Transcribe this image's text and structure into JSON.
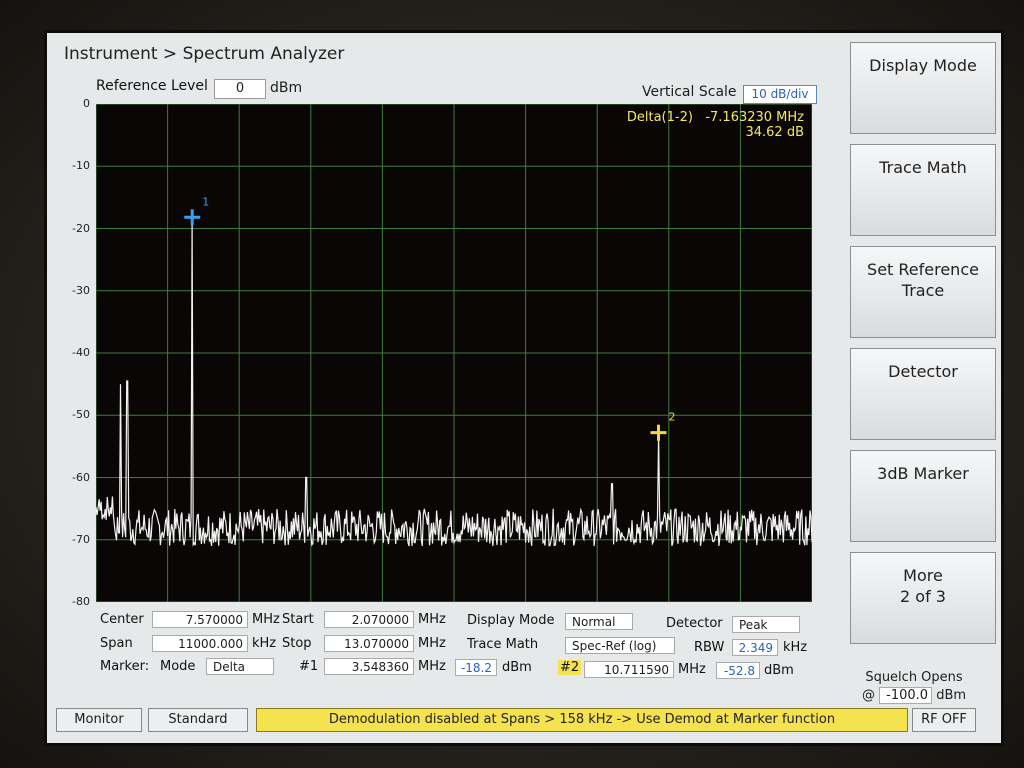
{
  "breadcrumb": "Instrument > Spectrum Analyzer",
  "reference_level": {
    "label": "Reference Level",
    "value": "0",
    "unit": "dBm"
  },
  "vertical_scale": {
    "label": "Vertical Scale",
    "value": "10 dB/div"
  },
  "delta": {
    "label": "Delta(1-2)",
    "freq": "-7.163230 MHz",
    "amp": "34.62 dB"
  },
  "chart_data": {
    "type": "line",
    "xlim": [
      2.07,
      13.07
    ],
    "ylim": [
      -80,
      0
    ],
    "y_ticks": [
      "0",
      "-10",
      "-20",
      "-30",
      "-40",
      "-50",
      "-60",
      "-70",
      "-80"
    ],
    "grid": true,
    "noise_floor": -68,
    "peaks": [
      {
        "x": 2.45,
        "y": -45
      },
      {
        "x": 2.55,
        "y": -44.5
      },
      {
        "x": 3.54836,
        "y": -18.2
      },
      {
        "x": 5.3,
        "y": -60
      },
      {
        "x": 10.0,
        "y": -61
      },
      {
        "x": 10.71159,
        "y": -52.8
      }
    ],
    "markers": [
      {
        "label": "1",
        "x": 3.54836,
        "y": -18.2,
        "color": "#3a9ff0"
      },
      {
        "label": "2",
        "x": 10.71159,
        "y": -52.8,
        "color": "#f0d84a"
      }
    ]
  },
  "settings": {
    "center_label": "Center",
    "center_value": "7.570000",
    "center_unit": "MHz",
    "start_label": "Start",
    "start_value": "2.070000",
    "start_unit": "MHz",
    "display_mode_label": "Display Mode",
    "display_mode_value": "Normal",
    "detector_label": "Detector",
    "detector_value": "Peak",
    "span_label": "Span",
    "span_value": "11000.000",
    "span_unit": "kHz",
    "stop_label": "Stop",
    "stop_value": "13.070000",
    "stop_unit": "MHz",
    "trace_math_label": "Trace Math",
    "trace_math_value": "Spec-Ref (log)",
    "rbw_label": "RBW",
    "rbw_value": "2.349",
    "rbw_unit": "kHz",
    "marker_label": "Marker:",
    "mode_label": "Mode",
    "mode_value": "Delta",
    "m1_label": "#1",
    "m1_freq": "3.548360",
    "m1_freq_unit": "MHz",
    "m1_amp": "-18.2",
    "m1_amp_unit": "dBm",
    "m2_label": "#2",
    "m2_freq": "10.711590",
    "m2_freq_unit": "MHz",
    "m2_amp": "-52.8",
    "m2_amp_unit": "dBm"
  },
  "softkeys": [
    "Display Mode",
    "Trace Math",
    "Set Reference\nTrace",
    "Detector",
    "3dB Marker",
    "More\n2 of 3"
  ],
  "squelch": {
    "label": "Squelch Opens",
    "at": "@",
    "value": "-100.0",
    "unit": "dBm"
  },
  "statusbar": {
    "monitor": "Monitor",
    "standard": "Standard",
    "message": "Demodulation disabled at Spans >  158 kHz  -> Use Demod at Marker function",
    "rf": "RF OFF"
  }
}
